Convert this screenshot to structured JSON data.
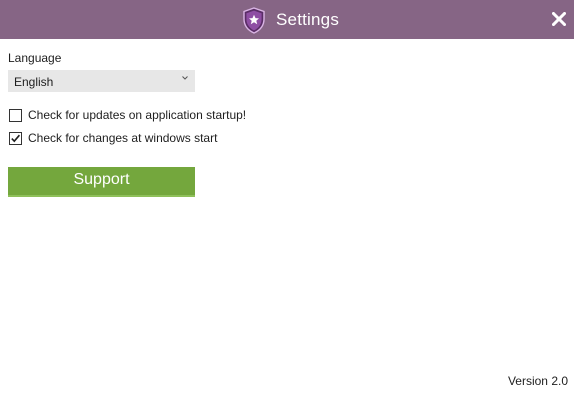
{
  "window": {
    "title": "Settings",
    "title_bar_color": "#866585",
    "logo_icon": "shield-star-icon",
    "close_icon": "close-icon"
  },
  "language": {
    "label": "Language",
    "selected": "English"
  },
  "options": {
    "check_updates": {
      "label": "Check for updates on application startup!",
      "checked": false
    },
    "check_changes": {
      "label": "Check for changes at windows start",
      "checked": true
    }
  },
  "support_button": {
    "label": "Support",
    "color": "#74a73d"
  },
  "footer": {
    "version": "Version 2.0"
  }
}
